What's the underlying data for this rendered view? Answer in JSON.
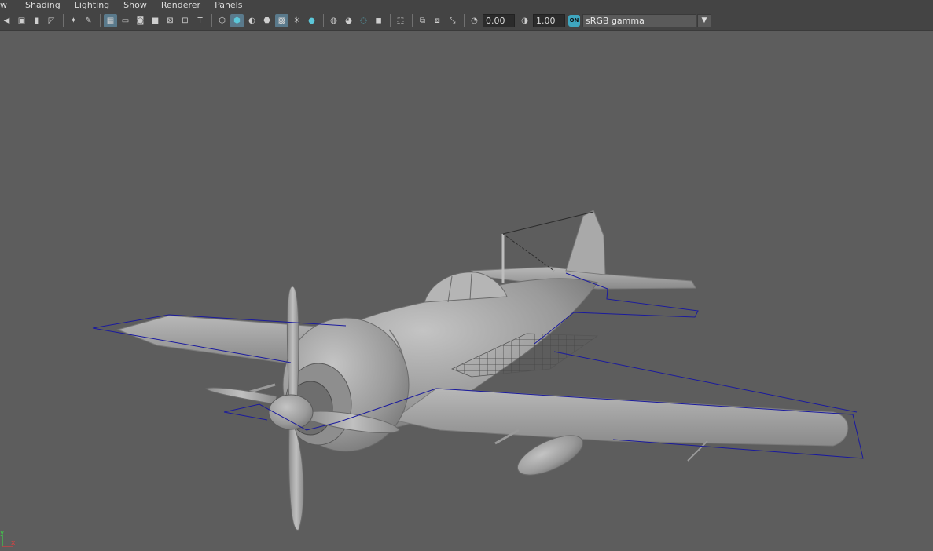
{
  "menubar": {
    "items": [
      "w",
      "Shading",
      "Lighting",
      "Show",
      "Renderer",
      "Panels"
    ]
  },
  "toolbar": {
    "exposure_value": "0.00",
    "gamma_value": "1.00",
    "color_management_badge": "ON",
    "color_space": "sRGB gamma",
    "icons": [
      "camera-select-icon",
      "camera-attributes-icon",
      "bookmark-icon",
      "image-plane-icon",
      "2d-pan-zoom-icon",
      "grease-pencil-icon",
      "grid-icon",
      "film-gate-icon",
      "resolution-gate-icon",
      "gate-mask-icon",
      "field-chart-icon",
      "safe-action-icon",
      "safe-title-icon",
      "wireframe-icon",
      "smooth-shade-icon",
      "default-material-icon",
      "wireframe-on-shaded-icon",
      "xray-icon",
      "use-all-lights-icon",
      "shadows-icon",
      "screen-space-ao-icon",
      "motion-blur-icon",
      "multisample-aa-icon",
      "depth-of-field-icon",
      "isolate-select-icon",
      "xray-joints-icon",
      "xray-active-icon",
      "exposure-icon",
      "gamma-icon"
    ]
  },
  "axis": {
    "y_label": "y",
    "x_label": "x",
    "y_color": "#3fd14a",
    "x_color": "#e04040"
  },
  "colors": {
    "viewport_bg": "#5d5d5d",
    "selection": "#1a1a9e",
    "toolbar_bg": "#444444"
  }
}
